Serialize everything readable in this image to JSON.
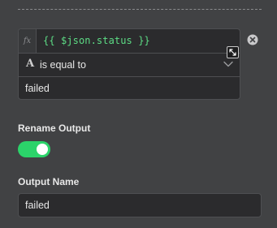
{
  "condition": {
    "fx_label": "fx",
    "expression": "{{ $json.status }}",
    "operator": {
      "type_icon_glyph": "A",
      "label": "is equal to"
    },
    "value": "failed"
  },
  "rename_output": {
    "label": "Rename Output",
    "enabled": true
  },
  "output_name": {
    "label": "Output Name",
    "value": "failed"
  },
  "colors": {
    "background": "#414244",
    "field_background": "#2b2b2d",
    "expression_green": "#5ddc85",
    "toggle_on": "#2bd36a"
  },
  "icons": {
    "remove": "close-circle-icon",
    "expand": "expand-icon",
    "dropdown": "chevron-down-icon",
    "type": "string-type-icon"
  }
}
